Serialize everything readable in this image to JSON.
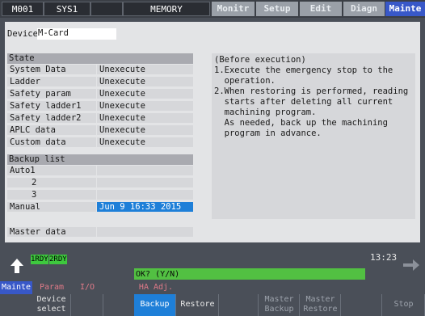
{
  "topbar": {
    "sys_tabs": [
      "M001",
      "SYS1",
      "",
      "MEMORY"
    ],
    "mode_tabs": [
      {
        "label": "Monitr",
        "active": false
      },
      {
        "label": "Setup",
        "active": false
      },
      {
        "label": "Edit",
        "active": false
      },
      {
        "label": "Diagn",
        "active": false
      },
      {
        "label": "Mainte",
        "active": true
      }
    ]
  },
  "device": {
    "label": "Device",
    "value": "M-Card"
  },
  "state": {
    "header": "State",
    "rows": [
      {
        "name": "System Data",
        "value": "Unexecute"
      },
      {
        "name": "Ladder",
        "value": "Unexecute"
      },
      {
        "name": "Safety param",
        "value": "Unexecute"
      },
      {
        "name": "Safety ladder1",
        "value": "Unexecute"
      },
      {
        "name": "Safety ladder2",
        "value": "Unexecute"
      },
      {
        "name": "APLC data",
        "value": "Unexecute"
      },
      {
        "name": "Custom data",
        "value": "Unexecute"
      }
    ]
  },
  "backup": {
    "header": "Backup list",
    "rows": [
      {
        "name": "Auto1",
        "value": ""
      },
      {
        "name": "2",
        "value": ""
      },
      {
        "name": "3",
        "value": ""
      },
      {
        "name": "Manual",
        "value": "Jun  9 16:33 2015"
      }
    ]
  },
  "master": {
    "label": "Master data",
    "value": ""
  },
  "info": {
    "lines": [
      "(Before execution)",
      "1.Execute the emergency stop to the",
      "  operation.",
      "2.When restoring is performed, reading",
      "  starts after deleting all current",
      "  machining program.",
      "  As needed, back up the machining",
      "  program in advance."
    ]
  },
  "status": {
    "rdy1": "1RDY",
    "rdy2": "2RDY",
    "prompt": "OK? (Y/N)",
    "time": "13:23"
  },
  "menu_top": [
    {
      "label": "Mainte"
    },
    {
      "label": "Param"
    },
    {
      "label": "I/O"
    },
    {
      "label": "HA Adj."
    }
  ],
  "menu_bottom": [
    {
      "label": "Device select"
    },
    {
      "label": ""
    },
    {
      "label": "Backup"
    },
    {
      "label": "Restore"
    },
    {
      "label": ""
    },
    {
      "label": "Master Backup"
    },
    {
      "label": "Master Restore"
    },
    {
      "label": ""
    },
    {
      "label": "Stop"
    }
  ],
  "colors": {
    "accent": "#3858c8",
    "ready": "#3ec83e",
    "prompt_bar": "#52c042",
    "selected": "#1e7fd8"
  }
}
